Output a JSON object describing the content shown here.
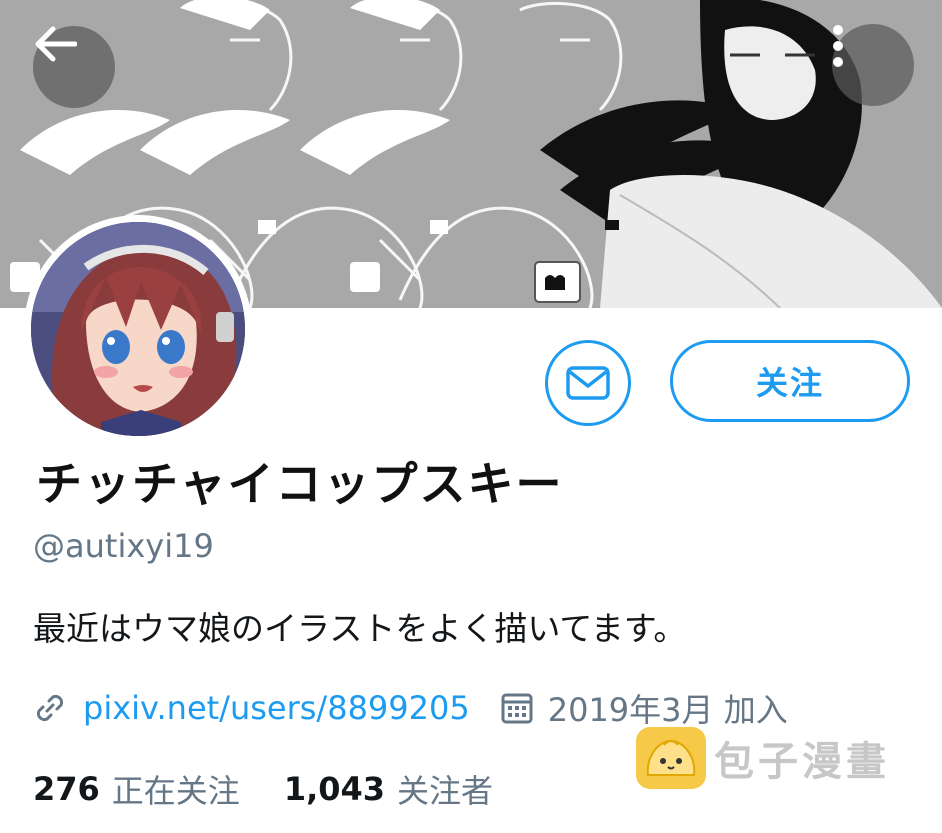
{
  "header": {
    "back_icon": "arrow-left-icon",
    "more_icon": "more-vertical-icon"
  },
  "profile": {
    "display_name": "チッチャイコップスキー",
    "handle": "@autixyi19",
    "bio": "最近はウマ娘のイラストをよく描いてます。",
    "link": "pixiv.net/users/8899205",
    "joined": "2019年3月 加入"
  },
  "actions": {
    "message_icon": "mail-icon",
    "follow_label": "关注"
  },
  "stats": {
    "following_count": "276",
    "following_label": "正在关注",
    "followers_count": "1,043",
    "followers_label": "关注者"
  },
  "watermark": {
    "text": "包子漫畫"
  },
  "colors": {
    "accent": "#1d9bf0",
    "muted_text": "#657786",
    "banner_gray": "#a9a9a9",
    "watermark_yellow": "#f7c948"
  }
}
